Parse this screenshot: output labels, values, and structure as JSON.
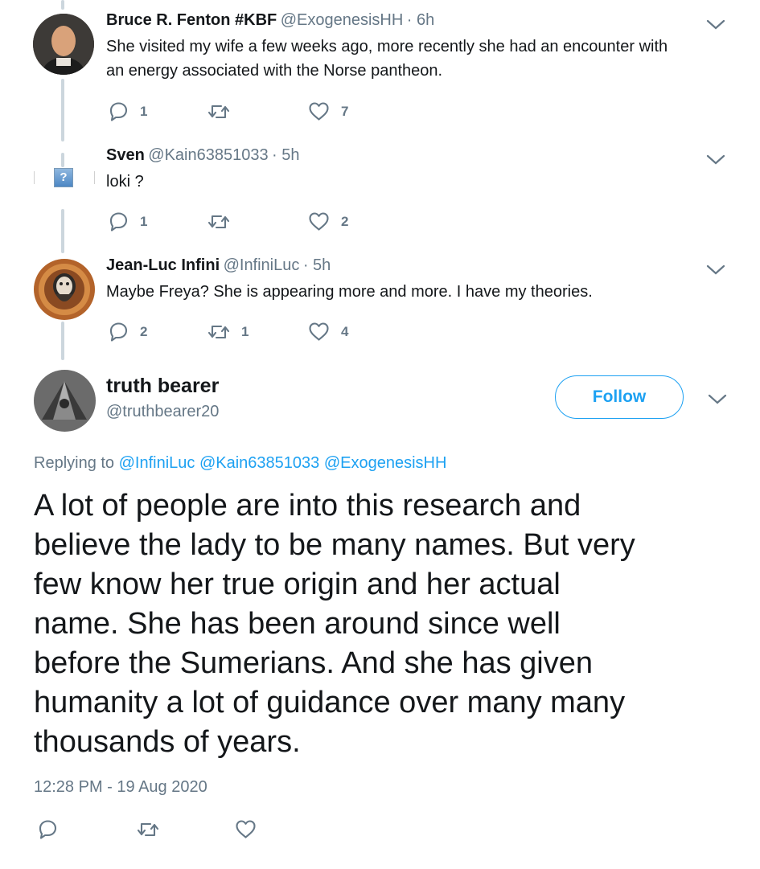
{
  "tweets": [
    {
      "name": "Bruce R. Fenton #KBF",
      "handle": "@ExogenesisHH",
      "time": "· 6h",
      "text_lines": [
        "She visited my wife a few weeks ago, more recently she had an encounter with",
        "an energy associated with the Norse pantheon."
      ],
      "reply_count": "1",
      "retweet_count": "",
      "like_count": "7"
    },
    {
      "name": "Sven",
      "handle": "@Kain63851033",
      "time": "· 5h",
      "text_lines": [
        "loki ?"
      ],
      "reply_count": "1",
      "retweet_count": "",
      "like_count": "2"
    },
    {
      "name": "Jean-Luc Infini",
      "handle": "@InfiniLuc",
      "time": "· 5h",
      "text_lines": [
        "Maybe Freya? She is appearing more and more. I have my theories."
      ],
      "reply_count": "2",
      "retweet_count": "1",
      "like_count": "4"
    }
  ],
  "main": {
    "name": "truth bearer",
    "handle": "@truthbearer20",
    "follow_label": "Follow",
    "replying_prefix": "Replying to",
    "replying_to": "@InfiniLuc @Kain63851033 @ExogenesisHH",
    "body_lines": [
      "A lot of people are into this research and",
      "believe the lady to be many names. But very",
      "few know her true origin and her actual",
      "name. She has been around since well",
      "before the Sumerians. And she has given",
      "humanity a lot of guidance over many many",
      "thousands of years."
    ],
    "timestamp": "12:28 PM - 19 Aug 2020"
  },
  "colors": {
    "accent": "#1da1f2",
    "muted": "#657786",
    "thread": "#ccd6dd"
  },
  "icons": [
    "reply-icon",
    "retweet-icon",
    "like-icon",
    "chevron-down-icon",
    "broken-image-icon"
  ]
}
